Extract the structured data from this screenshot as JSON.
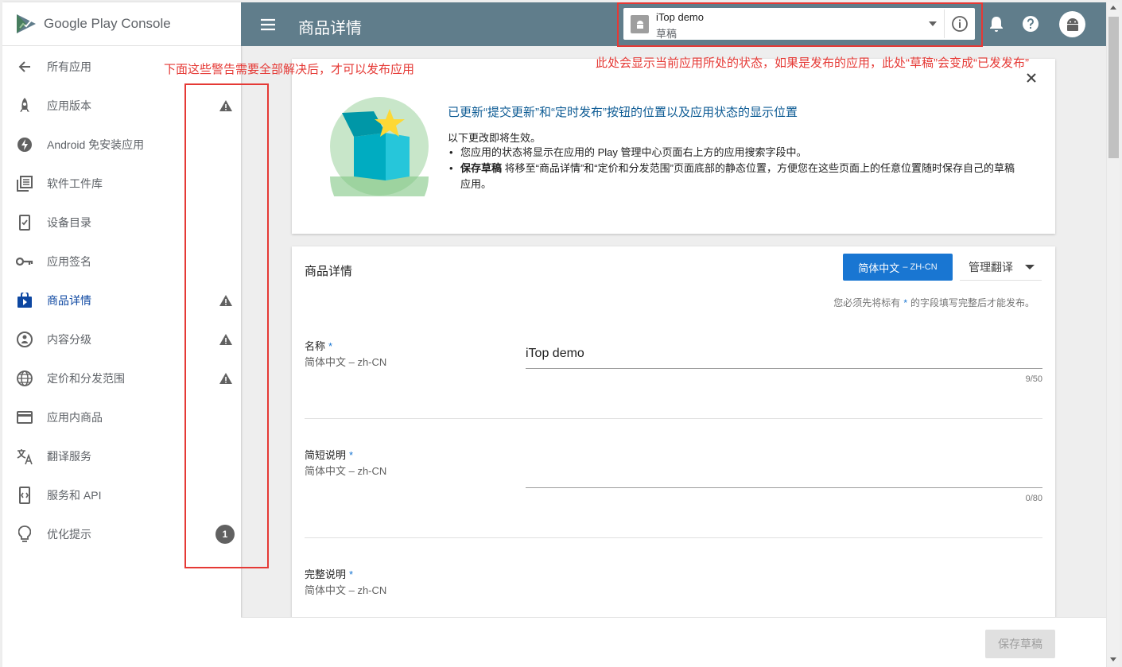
{
  "brand": {
    "name_google": "Google Play",
    "name_console": "Console"
  },
  "sidebar": {
    "back_label": "所有应用",
    "items": [
      {
        "label": "应用版本",
        "icon": "rocket-icon",
        "warning": true
      },
      {
        "label": "Android 免安装应用",
        "icon": "bolt-icon",
        "warning": false
      },
      {
        "label": "软件工件库",
        "icon": "library-icon",
        "warning": false
      },
      {
        "label": "设备目录",
        "icon": "devices-icon",
        "warning": false
      },
      {
        "label": "应用签名",
        "icon": "key-icon",
        "warning": false
      },
      {
        "label": "商品详情",
        "icon": "store-icon",
        "warning": true,
        "active": true
      },
      {
        "label": "内容分级",
        "icon": "rating-icon",
        "warning": true
      },
      {
        "label": "定价和分发范围",
        "icon": "globe-icon",
        "warning": true
      },
      {
        "label": "应用内商品",
        "icon": "card-icon",
        "warning": false
      },
      {
        "label": "翻译服务",
        "icon": "translate-icon",
        "warning": false
      },
      {
        "label": "服务和 API",
        "icon": "api-icon",
        "warning": false
      },
      {
        "label": "优化提示",
        "icon": "lightbulb-icon",
        "warning": false,
        "count": "1"
      }
    ]
  },
  "topbar": {
    "title": "商品详情",
    "app_name": "iTop demo",
    "app_status": "草稿"
  },
  "notice": {
    "title": "已更新“提交更新”和“定时发布”按钮的位置以及应用状态的显示位置",
    "intro": "以下更改即将生效。",
    "bullet1": "您应用的状态将显示在应用的 Play 管理中心页面右上方的应用搜索字段中。",
    "bullet2_bold": "保存草稿",
    "bullet2_rest": " 将移至“商品详情”和“定价和分发范围”页面底部的静态位置，方便您在这些页面上的任意位置随时保存自己的草稿应用。"
  },
  "main": {
    "title": "商品详情",
    "lang_button": "简体中文",
    "lang_code": "– ZH-CN",
    "manage_translations": "管理翻译",
    "required_note_pre": "您必须先将标有",
    "required_note_star": "*",
    "required_note_post": "的字段填写完整后才能发布。",
    "fields": [
      {
        "label": "名称",
        "star": "*",
        "sub": "简体中文 – zh-CN",
        "value": "iTop demo",
        "counter": "9/50"
      },
      {
        "label": "简短说明",
        "star": "*",
        "sub": "简体中文 – zh-CN",
        "value": "",
        "counter": "0/80"
      },
      {
        "label": "完整说明",
        "star": "*",
        "sub": "简体中文 – zh-CN",
        "value": "",
        "counter": ""
      }
    ]
  },
  "footer": {
    "save_draft": "保存草稿"
  },
  "annotations": {
    "left": "下面这些警告需要全部解决后，才可以发布应用",
    "right": "此处会显示当前应用所处的状态，如果是发布的应用，此处“草稿”会变成“已发发布”"
  },
  "colors": {
    "topbar": "#607d8b",
    "primary": "#1976d2",
    "active_nav": "#0d47a1",
    "annotation": "#e53935"
  }
}
